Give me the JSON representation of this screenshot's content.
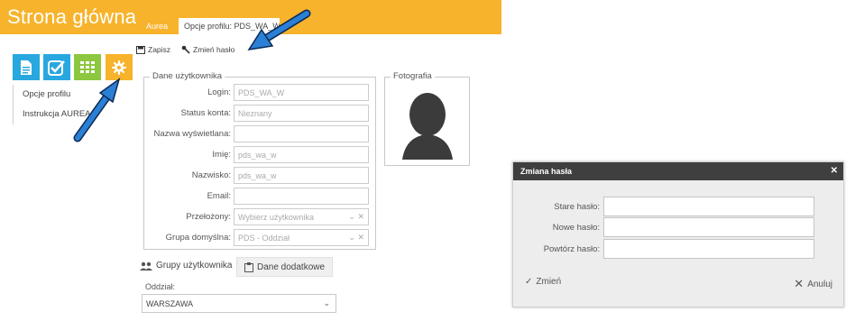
{
  "header": {
    "title": "Strona główna",
    "tabs": [
      {
        "label": "Aurea"
      },
      {
        "label": "Opcje profilu: PDS_WA_W"
      }
    ]
  },
  "tiles": [
    {
      "icon": "document-icon",
      "color": "#29a7df"
    },
    {
      "icon": "checkmark-icon",
      "color": "#29a7df"
    },
    {
      "icon": "grid-icon",
      "color": "#8dc63f"
    },
    {
      "icon": "gear-icon",
      "color": "#f7b32b"
    }
  ],
  "sidebar": {
    "items": [
      {
        "label": "Opcje profilu"
      },
      {
        "label": "Instrukcja AUREA"
      }
    ]
  },
  "toolbar": {
    "save_label": "Zapisz",
    "change_password_label": "Zmień hasło"
  },
  "user_form": {
    "legend": "Dane użytkownika",
    "fields": [
      {
        "label": "Login:",
        "value": "PDS_WA_W"
      },
      {
        "label": "Status konta:",
        "value": "Nieznany"
      },
      {
        "label": "Nazwa wyświetlana:",
        "value": ""
      },
      {
        "label": "Imię:",
        "value": "pds_wa_w"
      },
      {
        "label": "Nazwisko:",
        "value": "pds_wa_w"
      },
      {
        "label": "Email:",
        "value": ""
      },
      {
        "label": "Przełożony:",
        "placeholder": "Wybierz użytkownika"
      },
      {
        "label": "Grupa domyślna:",
        "value": "PDS - Oddział"
      }
    ]
  },
  "photo": {
    "legend": "Fotografia"
  },
  "bottom": {
    "groups_label": "Grupy użytkownika",
    "extra_label": "Dane dodatkowe",
    "branch_label": "Oddział:",
    "branch_value": "WARSZAWA"
  },
  "dialog": {
    "title": "Zmiana hasła",
    "fields": [
      {
        "label": "Stare hasło:"
      },
      {
        "label": "Nowe hasło:"
      },
      {
        "label": "Powtórz hasło:"
      }
    ],
    "confirm_label": "Zmień",
    "cancel_label": "Anuluj"
  },
  "colors": {
    "accent": "#f7b32b",
    "blue": "#29a7df",
    "green": "#8dc63f",
    "arrow": "#1f6fc7",
    "dialog_header": "#3f3f3f"
  }
}
